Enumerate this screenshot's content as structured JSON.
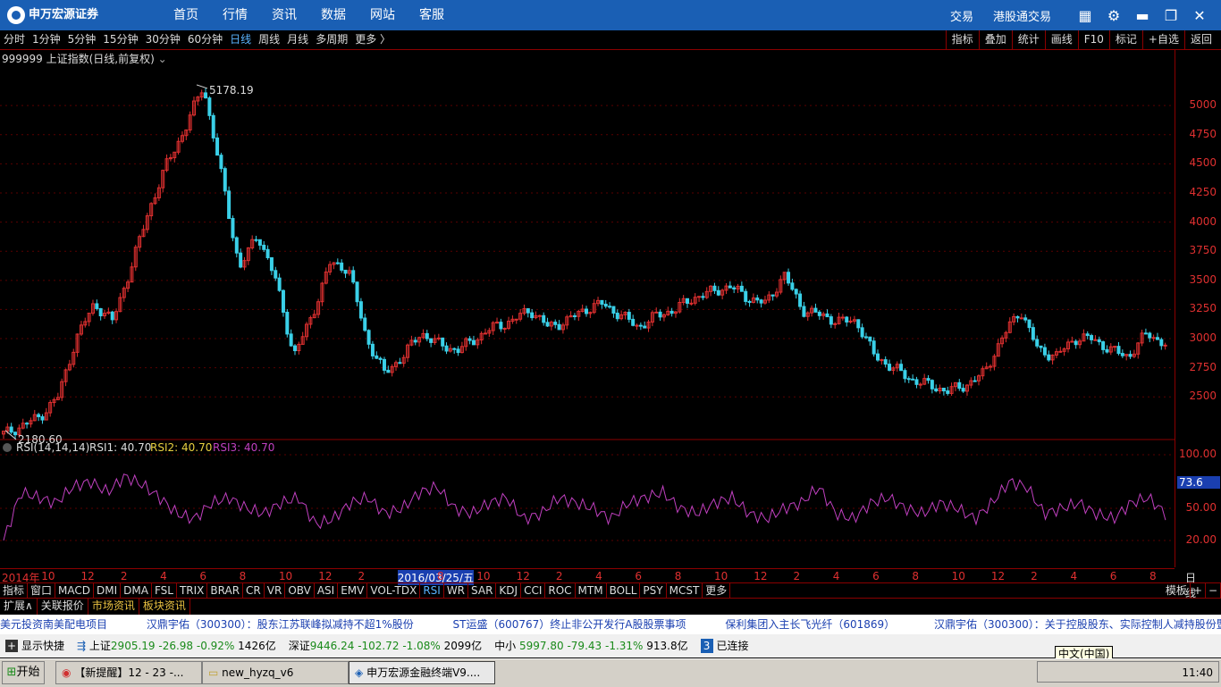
{
  "app": {
    "logo_text": "申万宏源证券",
    "nav": [
      "首页",
      "行情",
      "资讯",
      "数据",
      "网站",
      "客服"
    ],
    "top_right": [
      "交易",
      "港股通交易"
    ],
    "colors": {
      "topbar": "#1a5fb4",
      "up": "#e03030",
      "down": "#3ad0e8",
      "rsi": "#c040c0"
    }
  },
  "periods": [
    "分时",
    "1分钟",
    "5分钟",
    "15分钟",
    "30分钟",
    "60分钟",
    "日线",
    "周线",
    "月线",
    "多周期",
    "更多 〉"
  ],
  "active_period": "日线",
  "right_tools": [
    "指标",
    "叠加",
    "统计",
    "画线",
    "F10",
    "标记",
    "+自选",
    "返回"
  ],
  "chart_title": "999999 上证指数(日线,前复权)",
  "annotations": {
    "high": "5178.19",
    "low": "2180.60"
  },
  "chart_data": {
    "type": "line",
    "title": "999999 上证指数(日线,前复权)",
    "price_axis_ticks": [
      5000,
      4750,
      4500,
      4250,
      4000,
      3750,
      3500,
      3250,
      3000,
      2750,
      2500
    ],
    "price_high": 5178.19,
    "price_low": 2180.6,
    "close_points": [
      2181,
      2250,
      2330,
      2500,
      3000,
      3300,
      3150,
      3600,
      4100,
      4500,
      4800,
      5178,
      4400,
      3600,
      3900,
      3500,
      2850,
      3200,
      3650,
      3600,
      3000,
      2700,
      2850,
      3050,
      2950,
      2900,
      3000,
      3100,
      3150,
      3250,
      3100,
      3150,
      3250,
      3300,
      3200,
      3100,
      3200,
      3250,
      3350,
      3400,
      3450,
      3350,
      3300,
      3550,
      3250,
      3200,
      3150,
      3150,
      2850,
      2750,
      2650,
      2600,
      2550,
      2600,
      2700,
      3000,
      3250,
      2900,
      2850,
      3000,
      3000,
      2900,
      2850,
      3050,
      2950
    ],
    "rsi": {
      "label": "RSI(14,14,14)",
      "rsi1": "RSI1: 40.70",
      "rsi2": "RSI2: 40.70",
      "rsi3": "RSI3: 40.70",
      "axis_ticks": [
        "100.00",
        "73.6",
        "50.00",
        "20.00"
      ],
      "values": [
        20,
        65,
        60,
        55,
        70,
        75,
        65,
        80,
        72,
        60,
        45,
        40,
        55,
        60,
        50,
        45,
        55,
        60,
        35,
        40,
        55,
        60,
        45,
        50,
        65,
        70,
        50,
        45,
        55,
        60,
        40,
        45,
        60,
        55,
        50,
        40,
        55,
        60,
        65,
        50,
        45,
        55,
        60,
        45,
        40,
        50,
        55,
        70,
        45,
        40,
        55,
        60,
        50,
        45,
        55,
        50,
        40,
        55,
        75,
        70,
        45,
        50,
        55,
        45,
        40,
        55,
        60,
        45
      ]
    },
    "x_ticks": [
      "2014年",
      "10",
      "12",
      "2",
      "4",
      "6",
      "8",
      "10",
      "12",
      "2",
      "2016/03/25/五",
      "8",
      "10",
      "12",
      "2",
      "4",
      "6",
      "8",
      "10",
      "12",
      "2",
      "4",
      "6",
      "8",
      "10",
      "12",
      "2",
      "4",
      "6",
      "8"
    ]
  },
  "indicators": [
    "指标",
    "窗口",
    "MACD",
    "DMI",
    "DMA",
    "FSL",
    "TRIX",
    "BRAR",
    "CR",
    "VR",
    "OBV",
    "ASI",
    "EMV",
    "VOL-TDX",
    "RSI",
    "WR",
    "SAR",
    "KDJ",
    "CCI",
    "ROC",
    "MTM",
    "BOLL",
    "PSY",
    "MCST",
    "更多"
  ],
  "active_indicator": "RSI",
  "indicator_right": [
    "模板",
    "+",
    "−"
  ],
  "info_tabs": [
    "扩展∧",
    "关联报价",
    "市场资讯",
    "板块资讯"
  ],
  "ticker": [
    "美元投资南美配电项目",
    "汉鼎宇佑（300300）：股东江苏联峰拟减持不超1%股份",
    "ST运盛（600767）终止非公开发行A股股票事项",
    "保利集团入主长飞光纤（601869）",
    "汉鼎宇佑（300300）：关于控股股东、实际控制人减持股份暨权益变动"
  ],
  "status": {
    "show_shortcut": "显示快捷",
    "sh_label": "上证",
    "sh_price": "2905.19",
    "sh_chg": "-26.98",
    "sh_pct": "-0.92%",
    "sh_vol": "1426亿",
    "sz_label": "深证",
    "sz_price": "9446.24",
    "sz_chg": "-102.72",
    "sz_pct": "-1.08%",
    "sz_vol": "2099亿",
    "zx_label": "中小",
    "zx_price": "5997.80",
    "zx_chg": "-79.43",
    "zx_pct": "-1.31%",
    "zx_vol": "913.8亿",
    "conn_num": "3",
    "conn_text": "已连接"
  },
  "taskbar": {
    "start": "开始",
    "tasks": [
      "【新提醒】12 - 23 -...",
      "new_hyzq_v6",
      "申万宏源金融终端V9...."
    ],
    "ime_tooltip": "中文(中国)",
    "clock": "11:40"
  }
}
